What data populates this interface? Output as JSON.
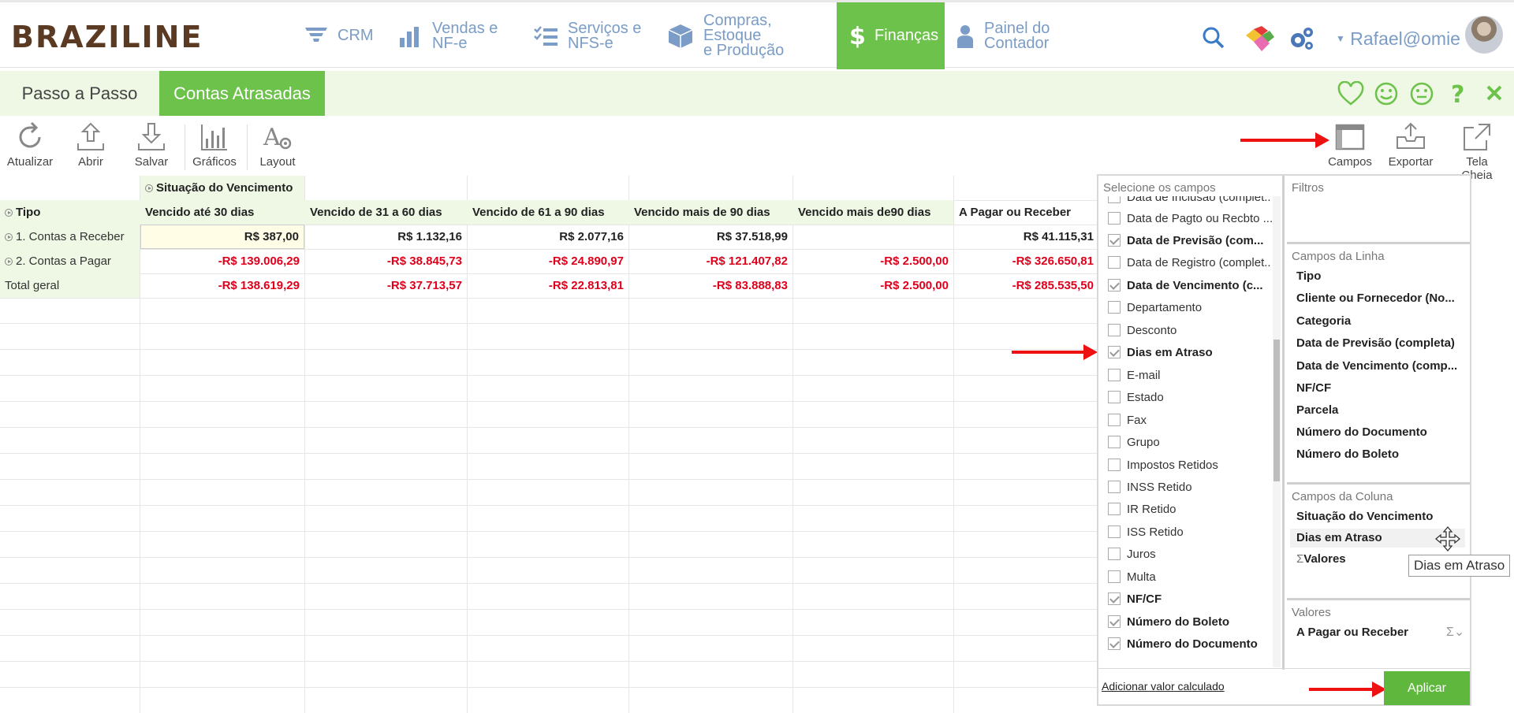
{
  "header": {
    "logo": "BRAZILINE",
    "nav": [
      {
        "label1": "CRM",
        "label2": ""
      },
      {
        "label1": "Vendas e",
        "label2": "NF-e"
      },
      {
        "label1": "Serviços e",
        "label2": "NFS-e"
      },
      {
        "label1": "Compras, Estoque",
        "label2": "e Produção"
      },
      {
        "label1": "Finanças",
        "label2": ""
      },
      {
        "label1": "Painel do",
        "label2": "Contador"
      }
    ],
    "user": "Rafael@omie",
    "colors": {
      "accent": "#6cc24a",
      "nav_text": "#7a9cc6",
      "logo": "#5b3a24"
    }
  },
  "tabs": [
    {
      "label": "Passo a Passo"
    },
    {
      "label": "Contas Atrasadas"
    }
  ],
  "toolbar": {
    "left": [
      "Atualizar",
      "Abrir",
      "Salvar",
      "Gráficos",
      "Layout"
    ],
    "right": [
      "Campos",
      "Exportar",
      "Tela Cheia"
    ]
  },
  "grid": {
    "column_field": "Situação do Vencimento",
    "row_field": "Tipo",
    "columns": [
      "Vencido até 30 dias",
      "Vencido de 31 a 60 dias",
      "Vencido de 61 a 90 dias",
      "Vencido mais de 90 dias",
      "Vencido mais de90 dias",
      "A Pagar ou Receber"
    ],
    "rows": [
      {
        "label": "1. Contas a Receber",
        "values": [
          "R$ 387,00",
          "R$ 1.132,16",
          "R$ 2.077,16",
          "R$ 37.518,99",
          "",
          "R$ 41.115,31"
        ]
      },
      {
        "label": "2. Contas a Pagar",
        "values": [
          "-R$ 139.006,29",
          "-R$ 38.845,73",
          "-R$ 24.890,97",
          "-R$ 121.407,82",
          "-R$ 2.500,00",
          "-R$ 326.650,81"
        ]
      },
      {
        "label": "Total geral",
        "values": [
          "-R$ 138.619,29",
          "-R$ 37.713,57",
          "-R$ 22.813,81",
          "-R$ 83.888,83",
          "-R$ 2.500,00",
          "-R$ 285.535,50"
        ]
      }
    ]
  },
  "field_list": {
    "title": "Selecione os campos",
    "items": [
      {
        "label": "Data de Inclusão (complet...",
        "checked": false
      },
      {
        "label": "Data de Pagto ou Recbto ...",
        "checked": false
      },
      {
        "label": "Data de Previsão (com...",
        "checked": true
      },
      {
        "label": "Data de Registro (complet...",
        "checked": false
      },
      {
        "label": "Data de Vencimento (c...",
        "checked": true
      },
      {
        "label": "Departamento",
        "checked": false
      },
      {
        "label": "Desconto",
        "checked": false
      },
      {
        "label": "Dias em Atraso",
        "checked": true
      },
      {
        "label": "E-mail",
        "checked": false
      },
      {
        "label": "Estado",
        "checked": false
      },
      {
        "label": "Fax",
        "checked": false
      },
      {
        "label": "Grupo",
        "checked": false
      },
      {
        "label": "Impostos Retidos",
        "checked": false
      },
      {
        "label": "INSS Retido",
        "checked": false
      },
      {
        "label": "IR Retido",
        "checked": false
      },
      {
        "label": "ISS Retido",
        "checked": false
      },
      {
        "label": "Juros",
        "checked": false
      },
      {
        "label": "Multa",
        "checked": false
      },
      {
        "label": "NF/CF",
        "checked": true
      },
      {
        "label": "Número do Boleto",
        "checked": true
      },
      {
        "label": "Número do Documento",
        "checked": true
      }
    ],
    "add_calc": "Adicionar valor calculado"
  },
  "areas": {
    "filters": {
      "title": "Filtros"
    },
    "rows": {
      "title": "Campos da Linha",
      "items": [
        "Tipo",
        "Cliente ou Fornecedor (No...",
        "Categoria",
        "Data de Previsão (completa)",
        "Data de Vencimento (comp...",
        "NF/CF",
        "Parcela",
        "Número do Documento",
        "Número do Boleto"
      ]
    },
    "columns": {
      "title": "Campos da Coluna",
      "items": [
        "Situação do Vencimento",
        "Dias em Atraso",
        "Valores"
      ]
    },
    "values": {
      "title": "Valores",
      "items": [
        "A Pagar ou Receber"
      ]
    }
  },
  "tooltip": "Dias em Atraso",
  "apply_button": "Aplicar"
}
